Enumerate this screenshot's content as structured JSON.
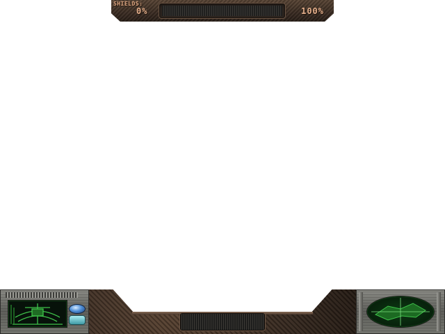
{
  "shields": {
    "label": "SHIELDS:",
    "min_label": "0%",
    "max_label": "100%",
    "level_fraction": 0
  },
  "console": {
    "left_panel": {
      "radar_icon": "vehicle-schematic-icon"
    },
    "right_panel": {
      "radar_icon": "terrain-radar-icon"
    }
  },
  "colors": {
    "rust_panel": "#3e2f25",
    "label_copper": "#e6b08c",
    "radar_green": "#3fc24a",
    "metal_gray": "#6f706a"
  }
}
